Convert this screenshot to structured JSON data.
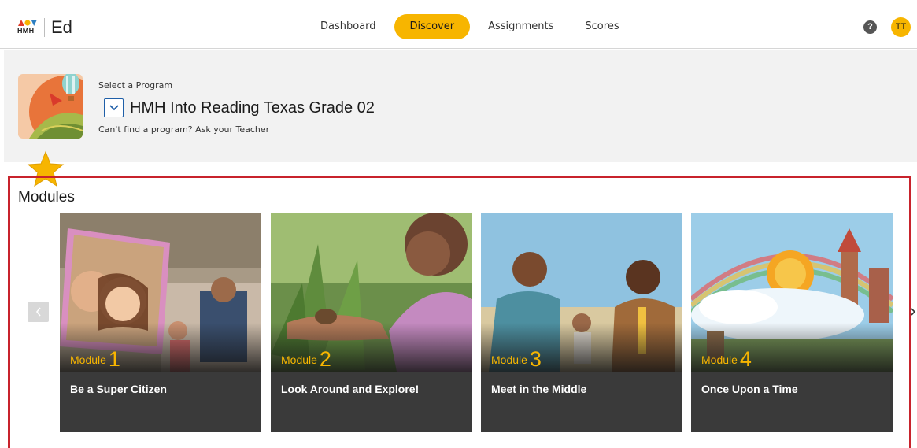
{
  "app": {
    "logo_text": "HMH",
    "product_name": "Ed",
    "avatar_initials": "TT",
    "help_glyph": "?"
  },
  "nav": {
    "items": [
      {
        "label": "Dashboard",
        "active": false
      },
      {
        "label": "Discover",
        "active": true
      },
      {
        "label": "Assignments",
        "active": false
      },
      {
        "label": "Scores",
        "active": false
      }
    ]
  },
  "program": {
    "select_label": "Select a Program",
    "title": "HMH Into Reading Texas Grade 02",
    "help_text": "Can't find a program? Ask your Teacher"
  },
  "modules": {
    "heading": "Modules",
    "cards": [
      {
        "module_word": "Module",
        "number": "1",
        "title": "Be a Super Citizen"
      },
      {
        "module_word": "Module",
        "number": "2",
        "title": "Look Around and Explore!"
      },
      {
        "module_word": "Module",
        "number": "3",
        "title": "Meet in the Middle"
      },
      {
        "module_word": "Module",
        "number": "4",
        "title": "Once Upon a Time"
      }
    ]
  },
  "icons": {
    "help": "help-circle-icon",
    "dropdown": "chevron-down-icon",
    "prev": "chevron-left-icon",
    "next": "chevron-right-icon",
    "badge": "star-icon"
  },
  "colors": {
    "accent": "#f7b500",
    "highlight_border": "#c8232c",
    "card_bg": "#3a3a3a"
  }
}
